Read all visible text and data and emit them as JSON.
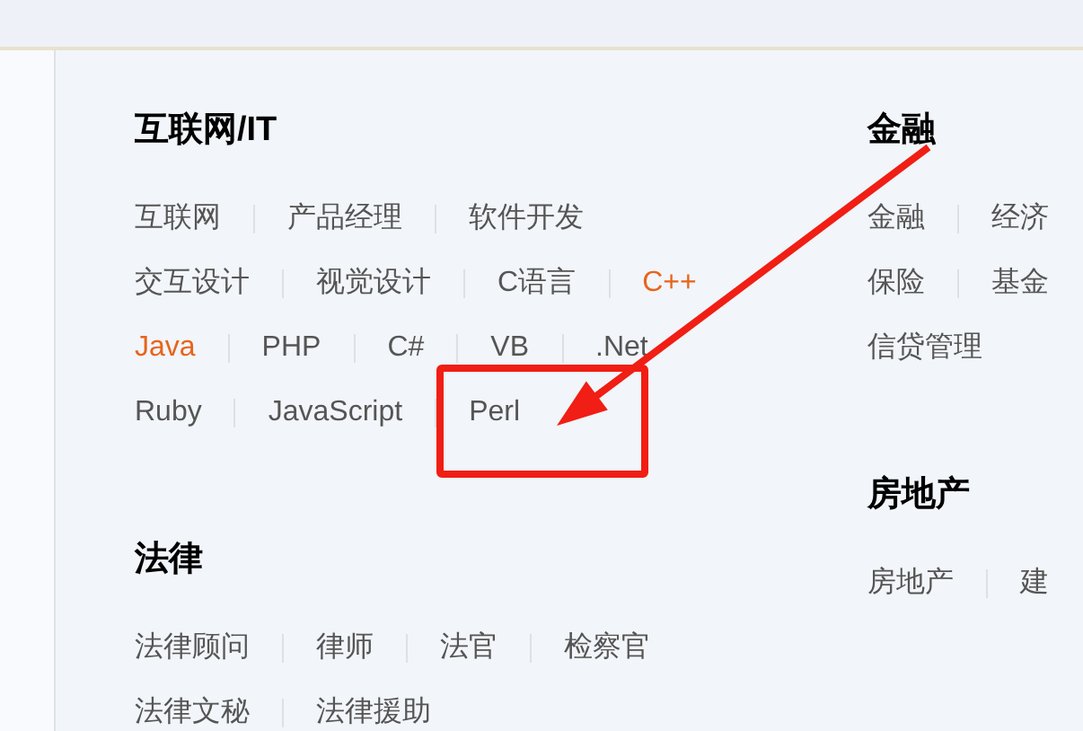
{
  "columns": [
    [
      {
        "title": "互联网/IT",
        "lines": [
          {
            "links": [
              {
                "label": "互联网",
                "highlighted": false
              },
              {
                "label": "产品经理",
                "highlighted": false
              },
              {
                "label": "软件开发",
                "highlighted": false
              }
            ]
          },
          {
            "links": [
              {
                "label": "交互设计",
                "highlighted": false
              },
              {
                "label": "视觉设计",
                "highlighted": false
              },
              {
                "label": "C语言",
                "highlighted": false
              },
              {
                "label": "C++",
                "highlighted": true
              }
            ]
          },
          {
            "links": [
              {
                "label": "Java",
                "highlighted": true
              },
              {
                "label": "PHP",
                "highlighted": false
              },
              {
                "label": "C#",
                "highlighted": false
              },
              {
                "label": "VB",
                "highlighted": false
              },
              {
                "label": ".Net",
                "highlighted": false
              }
            ]
          },
          {
            "links": [
              {
                "label": "Ruby",
                "highlighted": false
              },
              {
                "label": "JavaScript",
                "highlighted": false
              },
              {
                "label": "Perl",
                "highlighted": false
              }
            ]
          }
        ]
      },
      {
        "title": "法律",
        "lines": [
          {
            "links": [
              {
                "label": "法律顾问",
                "highlighted": false
              },
              {
                "label": "律师",
                "highlighted": false
              },
              {
                "label": "法官",
                "highlighted": false
              },
              {
                "label": "检察官",
                "highlighted": false
              }
            ]
          },
          {
            "links": [
              {
                "label": "法律文秘",
                "highlighted": false
              },
              {
                "label": "法律援助",
                "highlighted": false
              }
            ]
          }
        ]
      }
    ],
    [
      {
        "title": "金融",
        "lines": [
          {
            "links": [
              {
                "label": "金融",
                "highlighted": false
              },
              {
                "label": "经济",
                "highlighted": false
              }
            ]
          },
          {
            "links": [
              {
                "label": "保险",
                "highlighted": false
              },
              {
                "label": "基金",
                "highlighted": false
              }
            ]
          },
          {
            "links": [
              {
                "label": "信贷管理",
                "highlighted": false
              }
            ]
          }
        ]
      },
      {
        "title": "房地产",
        "lines": [
          {
            "links": [
              {
                "label": "房地产",
                "highlighted": false
              },
              {
                "label": "建",
                "highlighted": false
              }
            ]
          }
        ]
      }
    ]
  ]
}
